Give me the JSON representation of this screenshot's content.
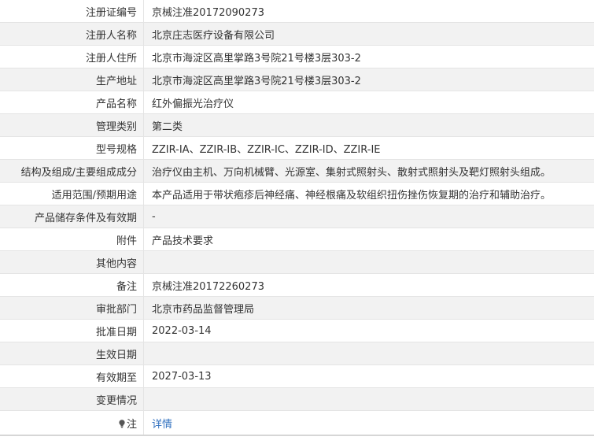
{
  "rows": [
    {
      "label": "注册证编号",
      "value": "京械注准20172090273"
    },
    {
      "label": "注册人名称",
      "value": "北京庄志医疗设备有限公司"
    },
    {
      "label": "注册人住所",
      "value": "北京市海淀区高里掌路3号院21号楼3层303-2"
    },
    {
      "label": "生产地址",
      "value": "北京市海淀区高里掌路3号院21号楼3层303-2"
    },
    {
      "label": "产品名称",
      "value": "红外偏振光治疗仪"
    },
    {
      "label": "管理类别",
      "value": "第二类"
    },
    {
      "label": "型号规格",
      "value": "ZZIR-IA、ZZIR-IB、ZZIR-IC、ZZIR-ID、ZZIR-IE"
    },
    {
      "label": "结构及组成/主要组成成分",
      "value": "治疗仪由主机、万向机械臂、光源室、集射式照射头、散射式照射头及靶灯照射头组成。"
    },
    {
      "label": "适用范围/预期用途",
      "value": "本产品适用于带状疱疹后神经痛、神经根痛及软组织扭伤挫伤恢复期的治疗和辅助治疗。"
    },
    {
      "label": "产品储存条件及有效期",
      "value": "-"
    },
    {
      "label": "附件",
      "value": "产品技术要求"
    },
    {
      "label": "其他内容",
      "value": ""
    },
    {
      "label": "备注",
      "value": "京械注准20172260273"
    },
    {
      "label": "审批部门",
      "value": "北京市药品监督管理局"
    },
    {
      "label": "批准日期",
      "value": "2022-03-14"
    },
    {
      "label": "生效日期",
      "value": ""
    },
    {
      "label": "有效期至",
      "value": "2027-03-13"
    },
    {
      "label": "变更情况",
      "value": ""
    }
  ],
  "note": {
    "icon": "lightbulb-icon",
    "label": "注",
    "link_text": "详情",
    "link_color": "#2f6fbf"
  }
}
